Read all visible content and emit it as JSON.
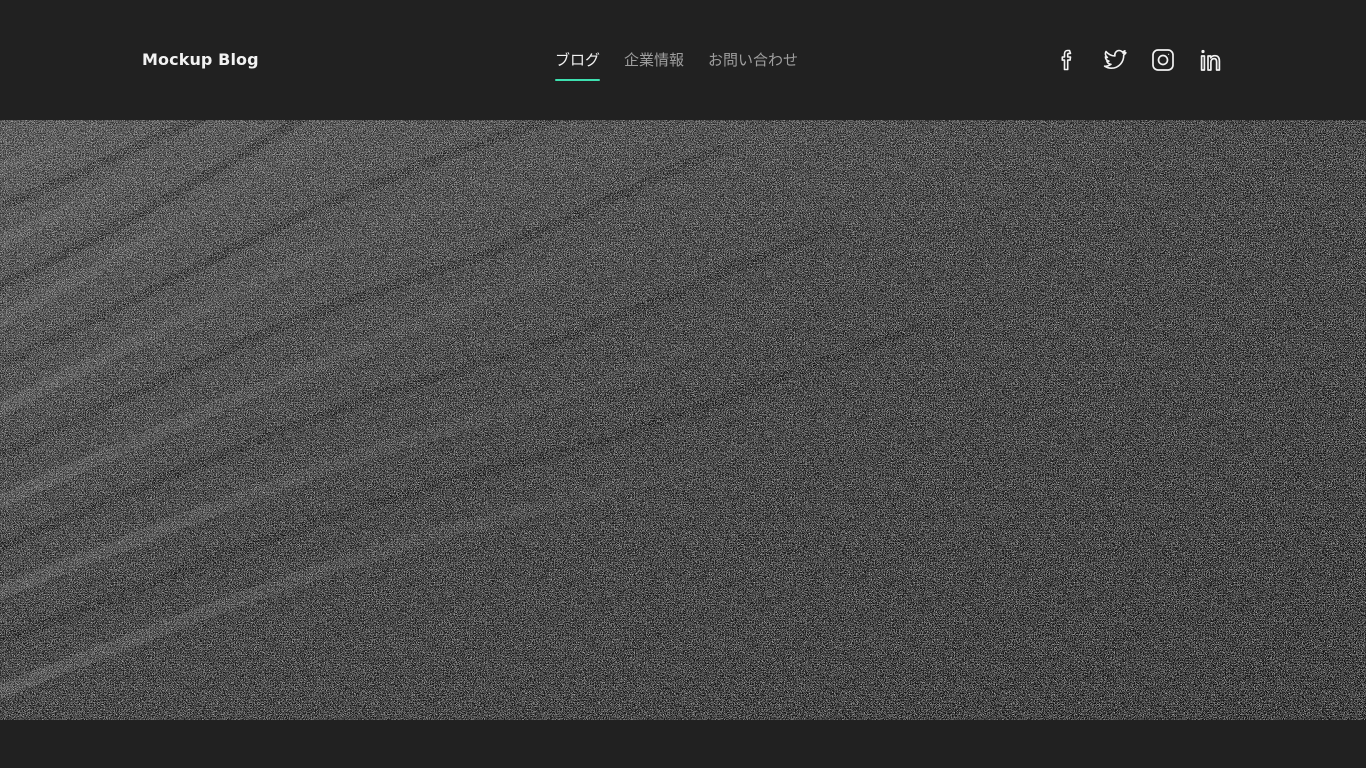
{
  "header": {
    "site_title": "Mockup Blog",
    "nav": [
      {
        "label": "ブログ",
        "active": true
      },
      {
        "label": "企業情報",
        "active": false
      },
      {
        "label": "お問い合わせ",
        "active": false
      }
    ],
    "social_icons": [
      "facebook-icon",
      "twitter-icon",
      "instagram-icon",
      "linkedin-icon"
    ]
  },
  "theme": {
    "background": "#212121",
    "accent": "#3ee0b0",
    "text_primary": "#f2f2f2",
    "text_secondary": "#9e9e9e"
  },
  "hero": {
    "description": "dark sand texture photograph"
  }
}
